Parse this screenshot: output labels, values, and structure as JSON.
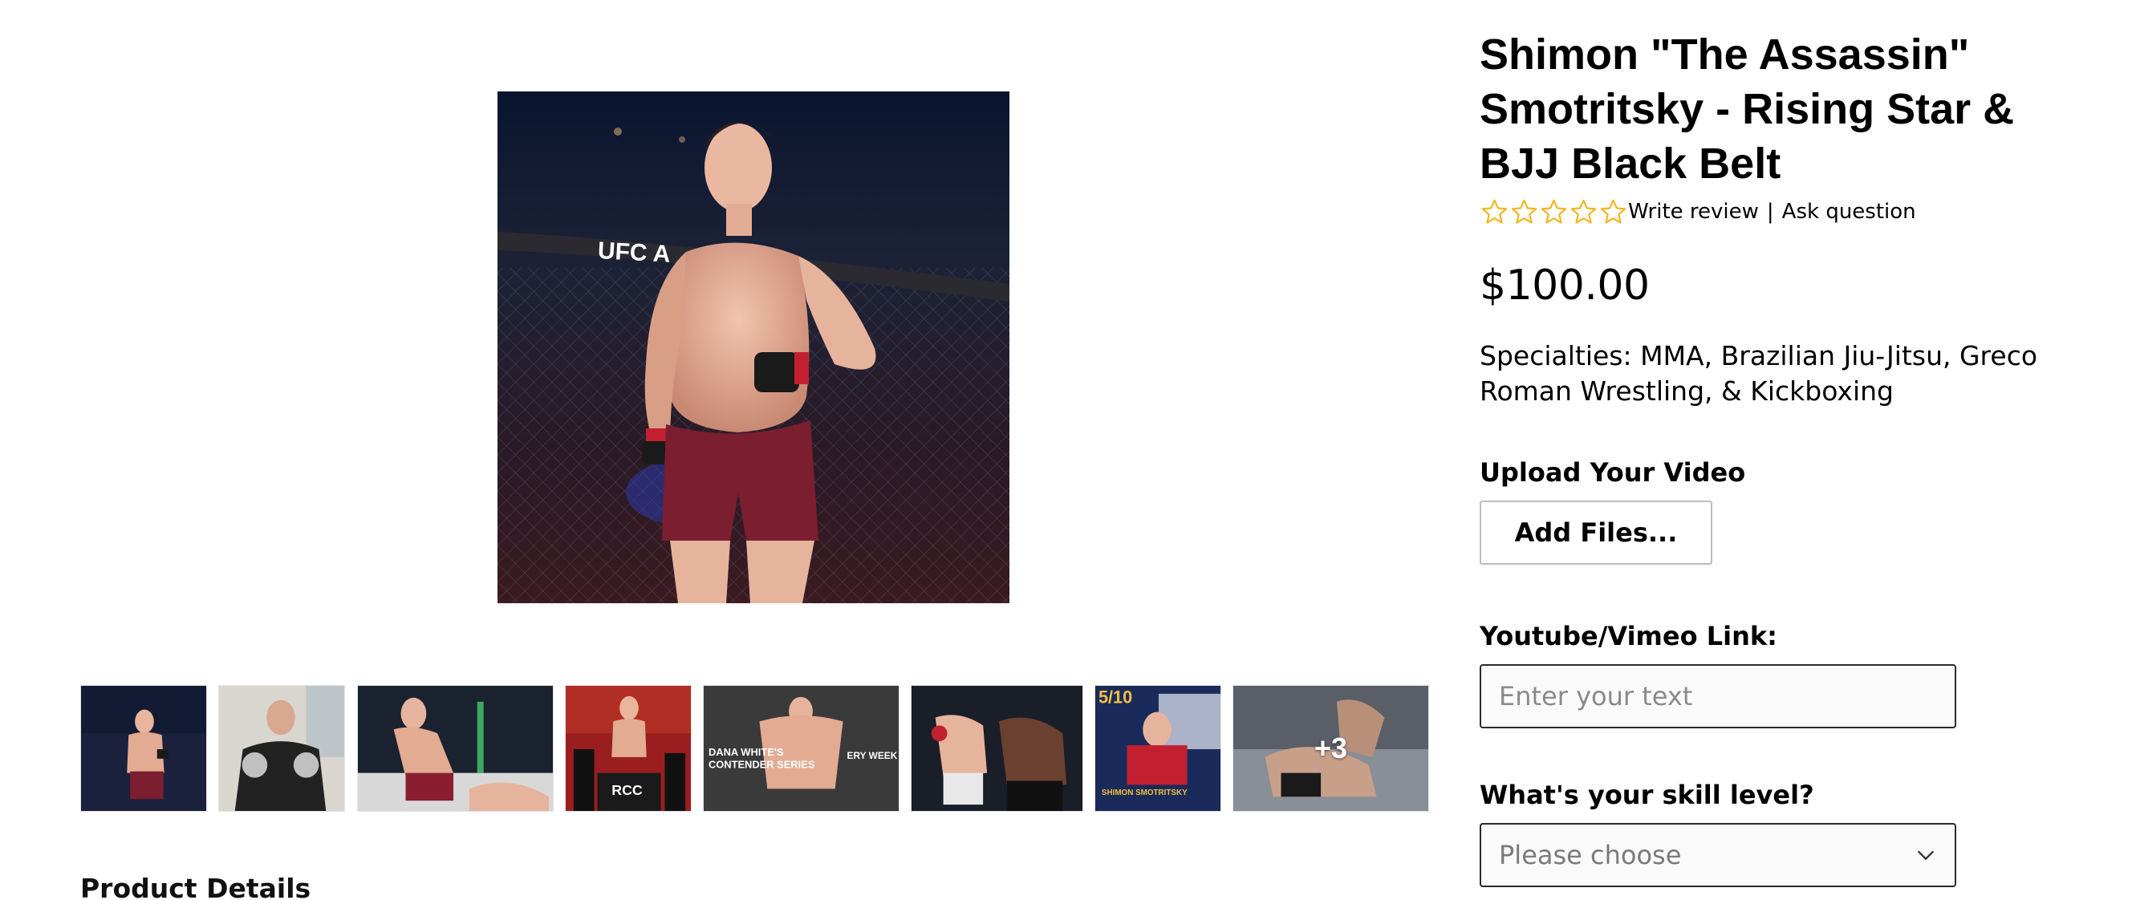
{
  "product": {
    "title": "Shimon \"The Assassin\" Smotritsky - Rising Star & BJJ Black Belt",
    "rating_stars": 5,
    "rating_filled": 0,
    "write_review": "Write review",
    "separator": "|",
    "ask_question": "Ask question",
    "price": "$100.00",
    "description": "Specialties: MMA, Brazilian Jiu-Jitsu, Greco Roman Wrestling, & Kickboxing"
  },
  "gallery": {
    "main_image_icon": "fighter-photo",
    "thumbnails": [
      {
        "name": "thumb-1",
        "icon": "fighter-cage-photo"
      },
      {
        "name": "thumb-2",
        "icon": "fighter-gloves-photo"
      },
      {
        "name": "thumb-3",
        "icon": "fight-action-photo"
      },
      {
        "name": "thumb-4",
        "icon": "weigh-in-photo"
      },
      {
        "name": "thumb-5",
        "icon": "contender-series-photo"
      },
      {
        "name": "thumb-6",
        "icon": "strike-action-photo"
      },
      {
        "name": "thumb-7",
        "icon": "promo-poster-photo"
      },
      {
        "name": "thumb-8",
        "icon": "grappling-photo"
      }
    ],
    "more_count": "+3"
  },
  "poster_text": {
    "date": "5/10",
    "fighter": "SHIMON SMOTRITSKY",
    "ufc": "UFC A",
    "rcc": "RCC",
    "dana": "DANA WHITE'S",
    "contender": "CONTENDER SERIES",
    "week": "ERY WEEK"
  },
  "form": {
    "upload_label": "Upload Your Video",
    "add_files_label": "Add Files...",
    "link_label": "Youtube/Vimeo Link:",
    "link_placeholder": "Enter your text",
    "link_value": "",
    "skill_label": "What's your skill level?",
    "skill_selected": "Please choose"
  },
  "sections": {
    "product_details": "Product Details"
  },
  "colors": {
    "star": "#f2b51c",
    "border": "#2a2a2a"
  }
}
